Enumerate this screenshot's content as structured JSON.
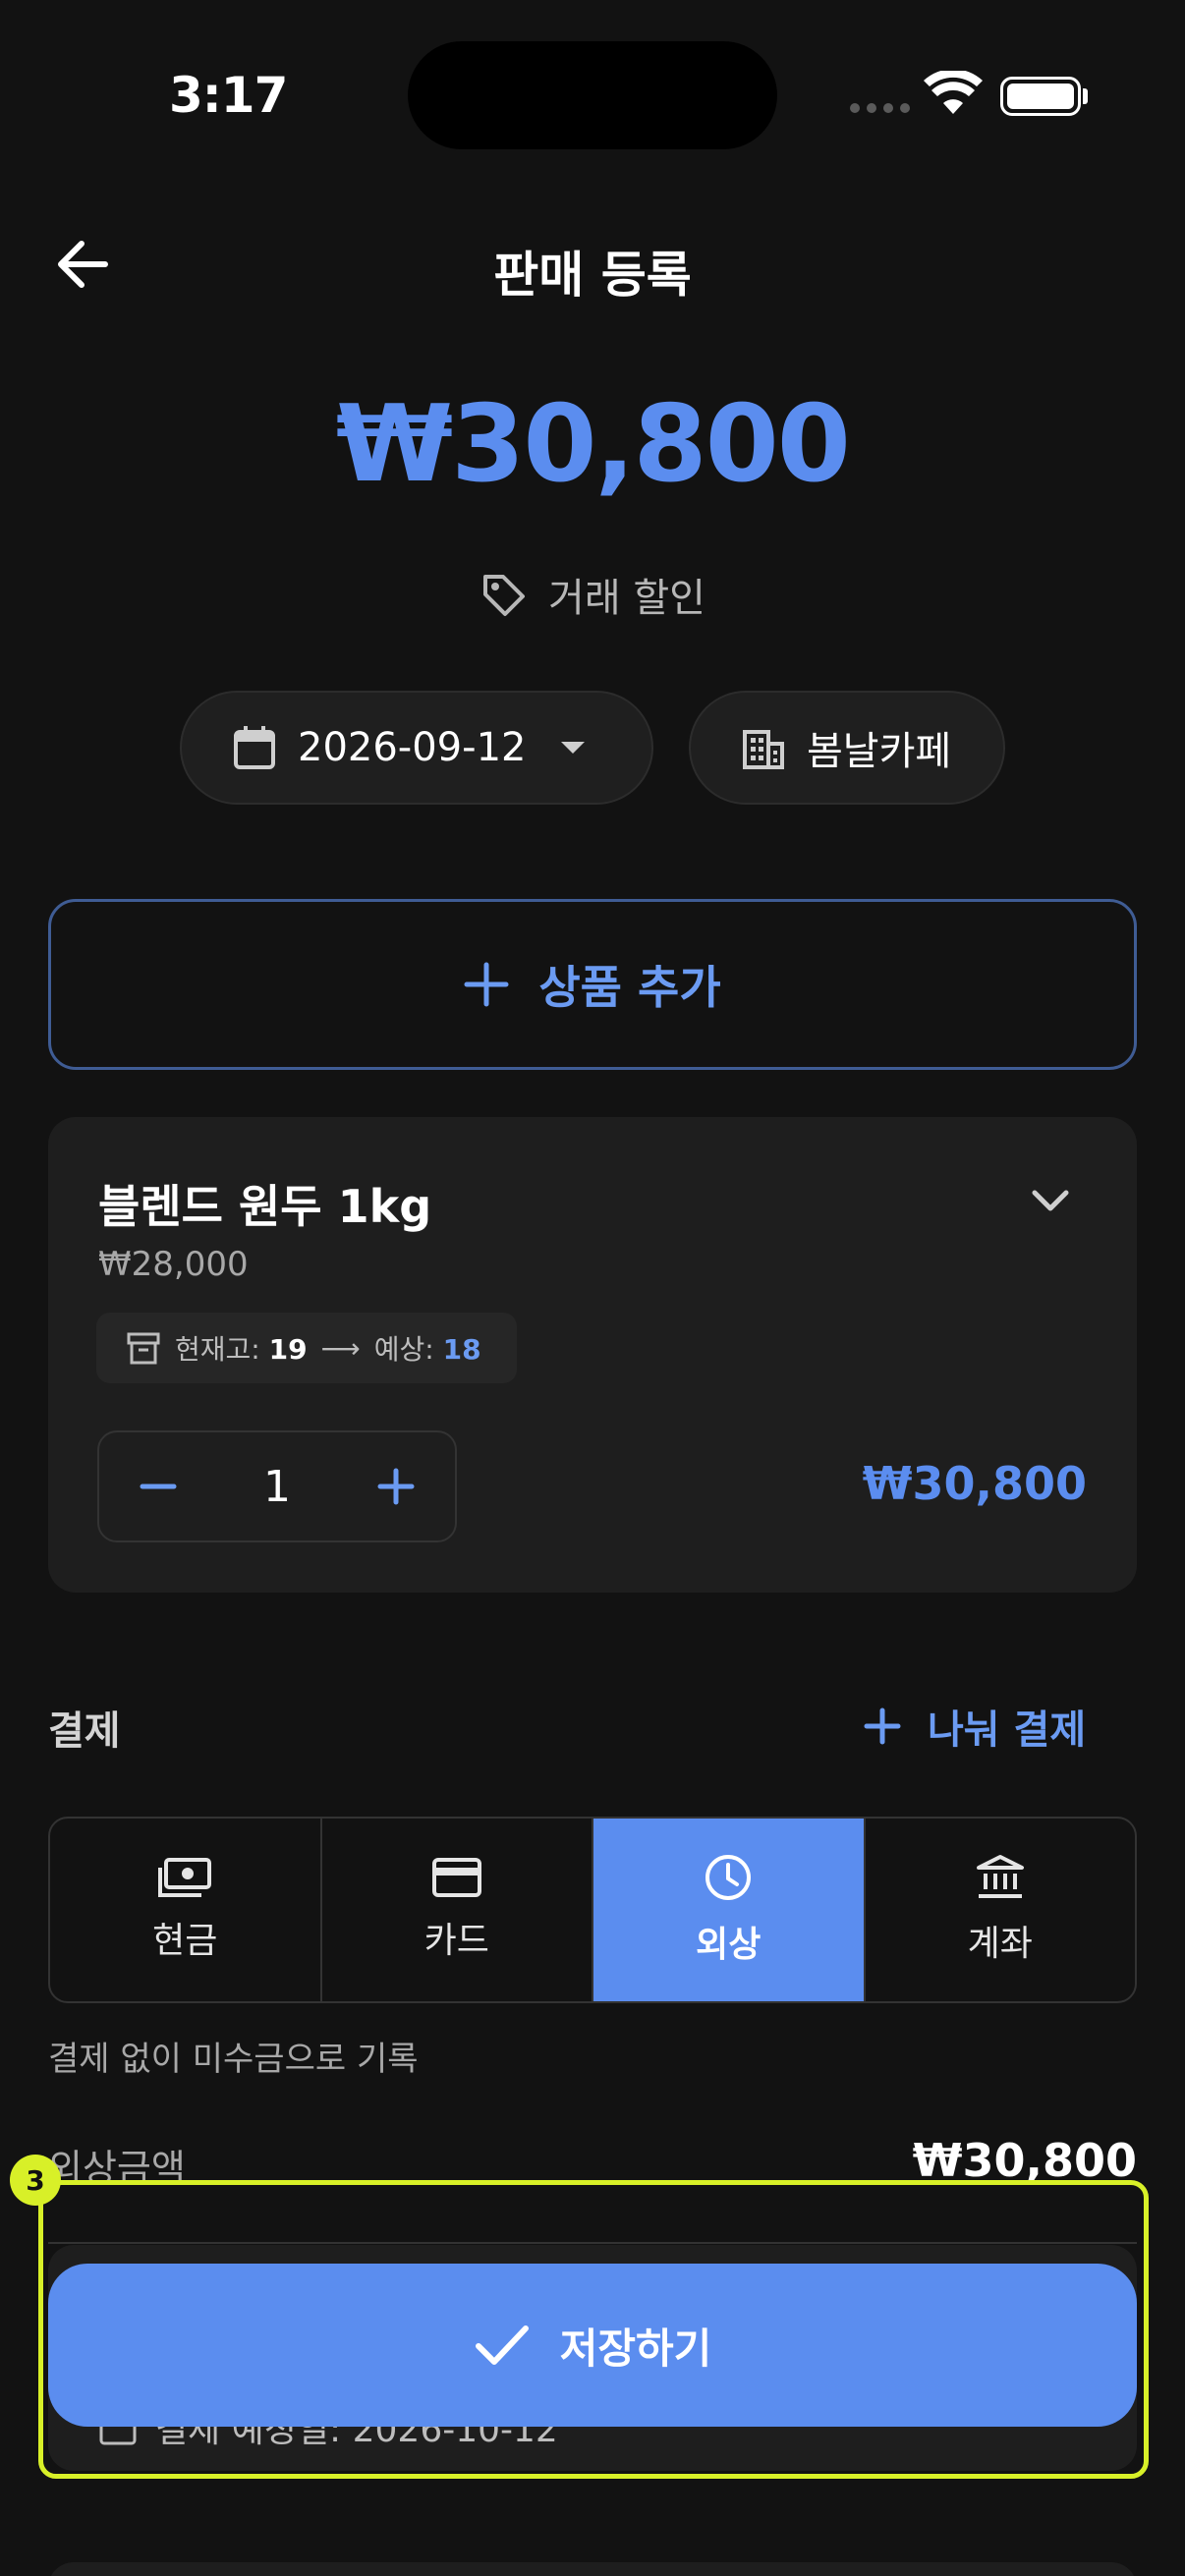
{
  "status_bar": {
    "time": "3:17"
  },
  "header": {
    "title": "판매 등록",
    "back_icon": "arrow-left-icon"
  },
  "summary": {
    "total": "₩30,800",
    "discount_label": "거래 할인"
  },
  "filters": {
    "date": "2026-09-12",
    "store": "봄날카페"
  },
  "add_product_label": "상품 추가",
  "product": {
    "name": "블렌드 원두 1kg",
    "unit_price": "₩28,000",
    "stock_label": "현재고:",
    "stock_current": "19",
    "stock_expected_label": "예상:",
    "stock_expected": "18",
    "quantity": "1",
    "line_total": "₩30,800"
  },
  "payment": {
    "label": "결제",
    "split_label": "나눠 결제",
    "methods": [
      {
        "label": "현금",
        "icon": "cash-icon",
        "active": false
      },
      {
        "label": "카드",
        "icon": "card-icon",
        "active": false
      },
      {
        "label": "외상",
        "icon": "clock-icon",
        "active": true
      },
      {
        "label": "계좌",
        "icon": "bank-icon",
        "active": false
      }
    ],
    "note": "결제 없이 미수금으로 기록",
    "credit_label": "외상금액",
    "credit_amount": "₩30,800",
    "due_text": "결제 예정일: 2026-10-12"
  },
  "save_label": "저장하기",
  "annotation_badge": "3",
  "colors": {
    "accent": "#5b8def",
    "background": "#121212",
    "card": "#1e1e1e",
    "highlight": "#d8f028"
  }
}
